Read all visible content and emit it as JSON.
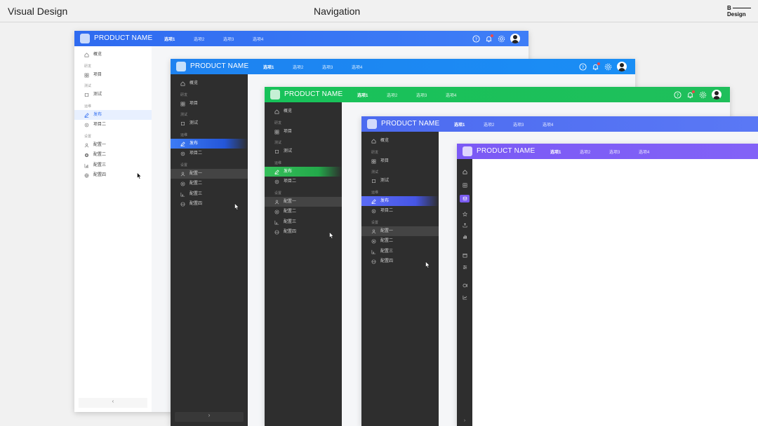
{
  "slide": {
    "title_left": "Visual Design",
    "title_center": "Navigation",
    "brand_top": "B",
    "brand_bottom": "Design"
  },
  "product_name": "PRODUCT NAME",
  "tabs": [
    "选项1",
    "选项2",
    "选项3",
    "选项4"
  ],
  "nav": {
    "overview": "概览",
    "group_research": "研发",
    "project": "项目",
    "group_test": "测试",
    "test": "测试",
    "group_ops": "运维",
    "publish": "发布",
    "project_two": "项目二",
    "group_settings": "设置",
    "config1": "配置一",
    "config2": "配置二",
    "config3": "配置三",
    "config4": "配置四"
  },
  "header_icons": [
    "help-icon",
    "bell-icon",
    "gear-icon",
    "avatar"
  ],
  "collapse_left": "‹",
  "collapse_right": "›",
  "themes": {
    "blue_light": "#2f6bf0",
    "blue_bright": "#1e82f0",
    "green": "#18c25a",
    "indigo": "#4c6bf0",
    "purple": "#7b5af5"
  }
}
